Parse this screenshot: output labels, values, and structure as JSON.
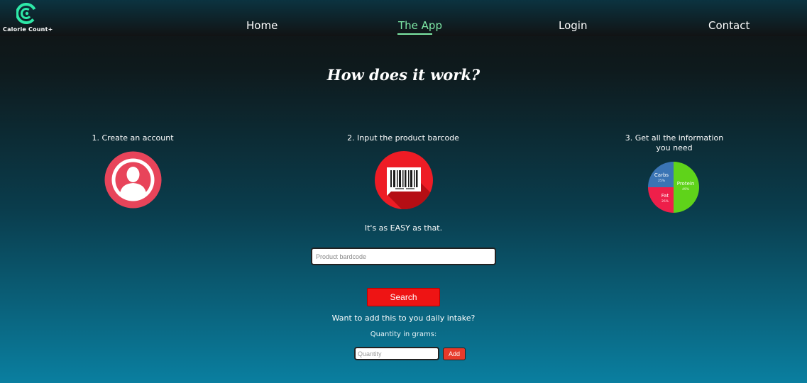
{
  "brand": {
    "name": "Calorie Count+",
    "accent": "#2ee8a8"
  },
  "nav": {
    "items": [
      {
        "label": "Home"
      },
      {
        "label": "The App"
      },
      {
        "label": "Login"
      },
      {
        "label": "Contact"
      }
    ],
    "active": "The App",
    "active_color": "#7ee8a6"
  },
  "main": {
    "title": "How does it work?",
    "steps": [
      {
        "label": "1. Create an account",
        "icon": "user-icon"
      },
      {
        "label": "2. Input the product barcode",
        "icon": "barcode-icon"
      },
      {
        "label": "3. Get all the information you need",
        "icon": "macro-pie-icon"
      }
    ],
    "pie": {
      "slices": [
        {
          "label": "Protein",
          "percent": "49%",
          "value": 49,
          "color": "#5fd31a"
        },
        {
          "label": "Fat",
          "percent": "26%",
          "value": 26,
          "color": "#ee1f4a"
        },
        {
          "label": "Carbs",
          "percent": "25%",
          "value": 25,
          "color": "#3a74b4"
        }
      ]
    },
    "tagline": "It's as EASY as that."
  },
  "search": {
    "placeholder": "Product bardcode",
    "button_label": "Search"
  },
  "intake": {
    "prompt": "Want to add this to you daily intake?",
    "quantity_label": "Quantity in grams:",
    "quantity_placeholder": "Quantity",
    "add_label": "Add"
  }
}
